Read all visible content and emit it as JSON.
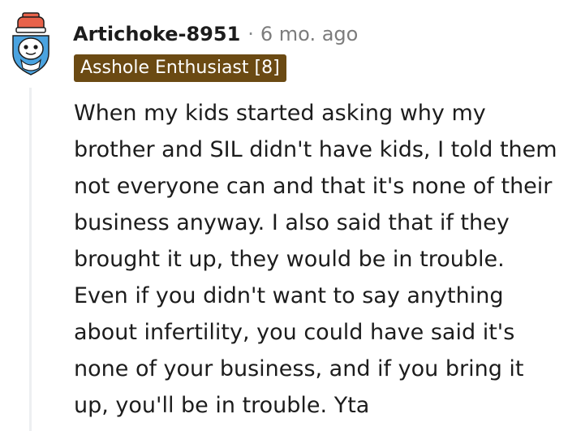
{
  "comment": {
    "username": "Artichoke-8951",
    "separator": "·",
    "timestamp": "6 mo. ago",
    "flair": "Asshole Enthusiast [8]",
    "body": "When my kids started asking why my brother and SIL didn't have kids, I told them not everyone can and that it's none of their business anyway. I also said that if they brought it up, they would be in trouble. Even if you didn't want to say anything about infertility, you could have said it's none of your business, and if you bring it up, you'll be in trouble. Yta"
  },
  "avatar": {
    "icon": "snoo-avatar-icon",
    "colors": {
      "hat": "#e8624a",
      "hat_band": "#ffffff",
      "shield": "#4aa3e0",
      "face": "#ffffff",
      "outline": "#1c1c1c"
    }
  },
  "colors": {
    "username": "#1c1c1c",
    "timestamp": "#7c7c7c",
    "flair_background": "#6b4a13",
    "flair_text": "#ffffff",
    "body_text": "#1c1c1c",
    "thread_line": "#edeff1"
  }
}
